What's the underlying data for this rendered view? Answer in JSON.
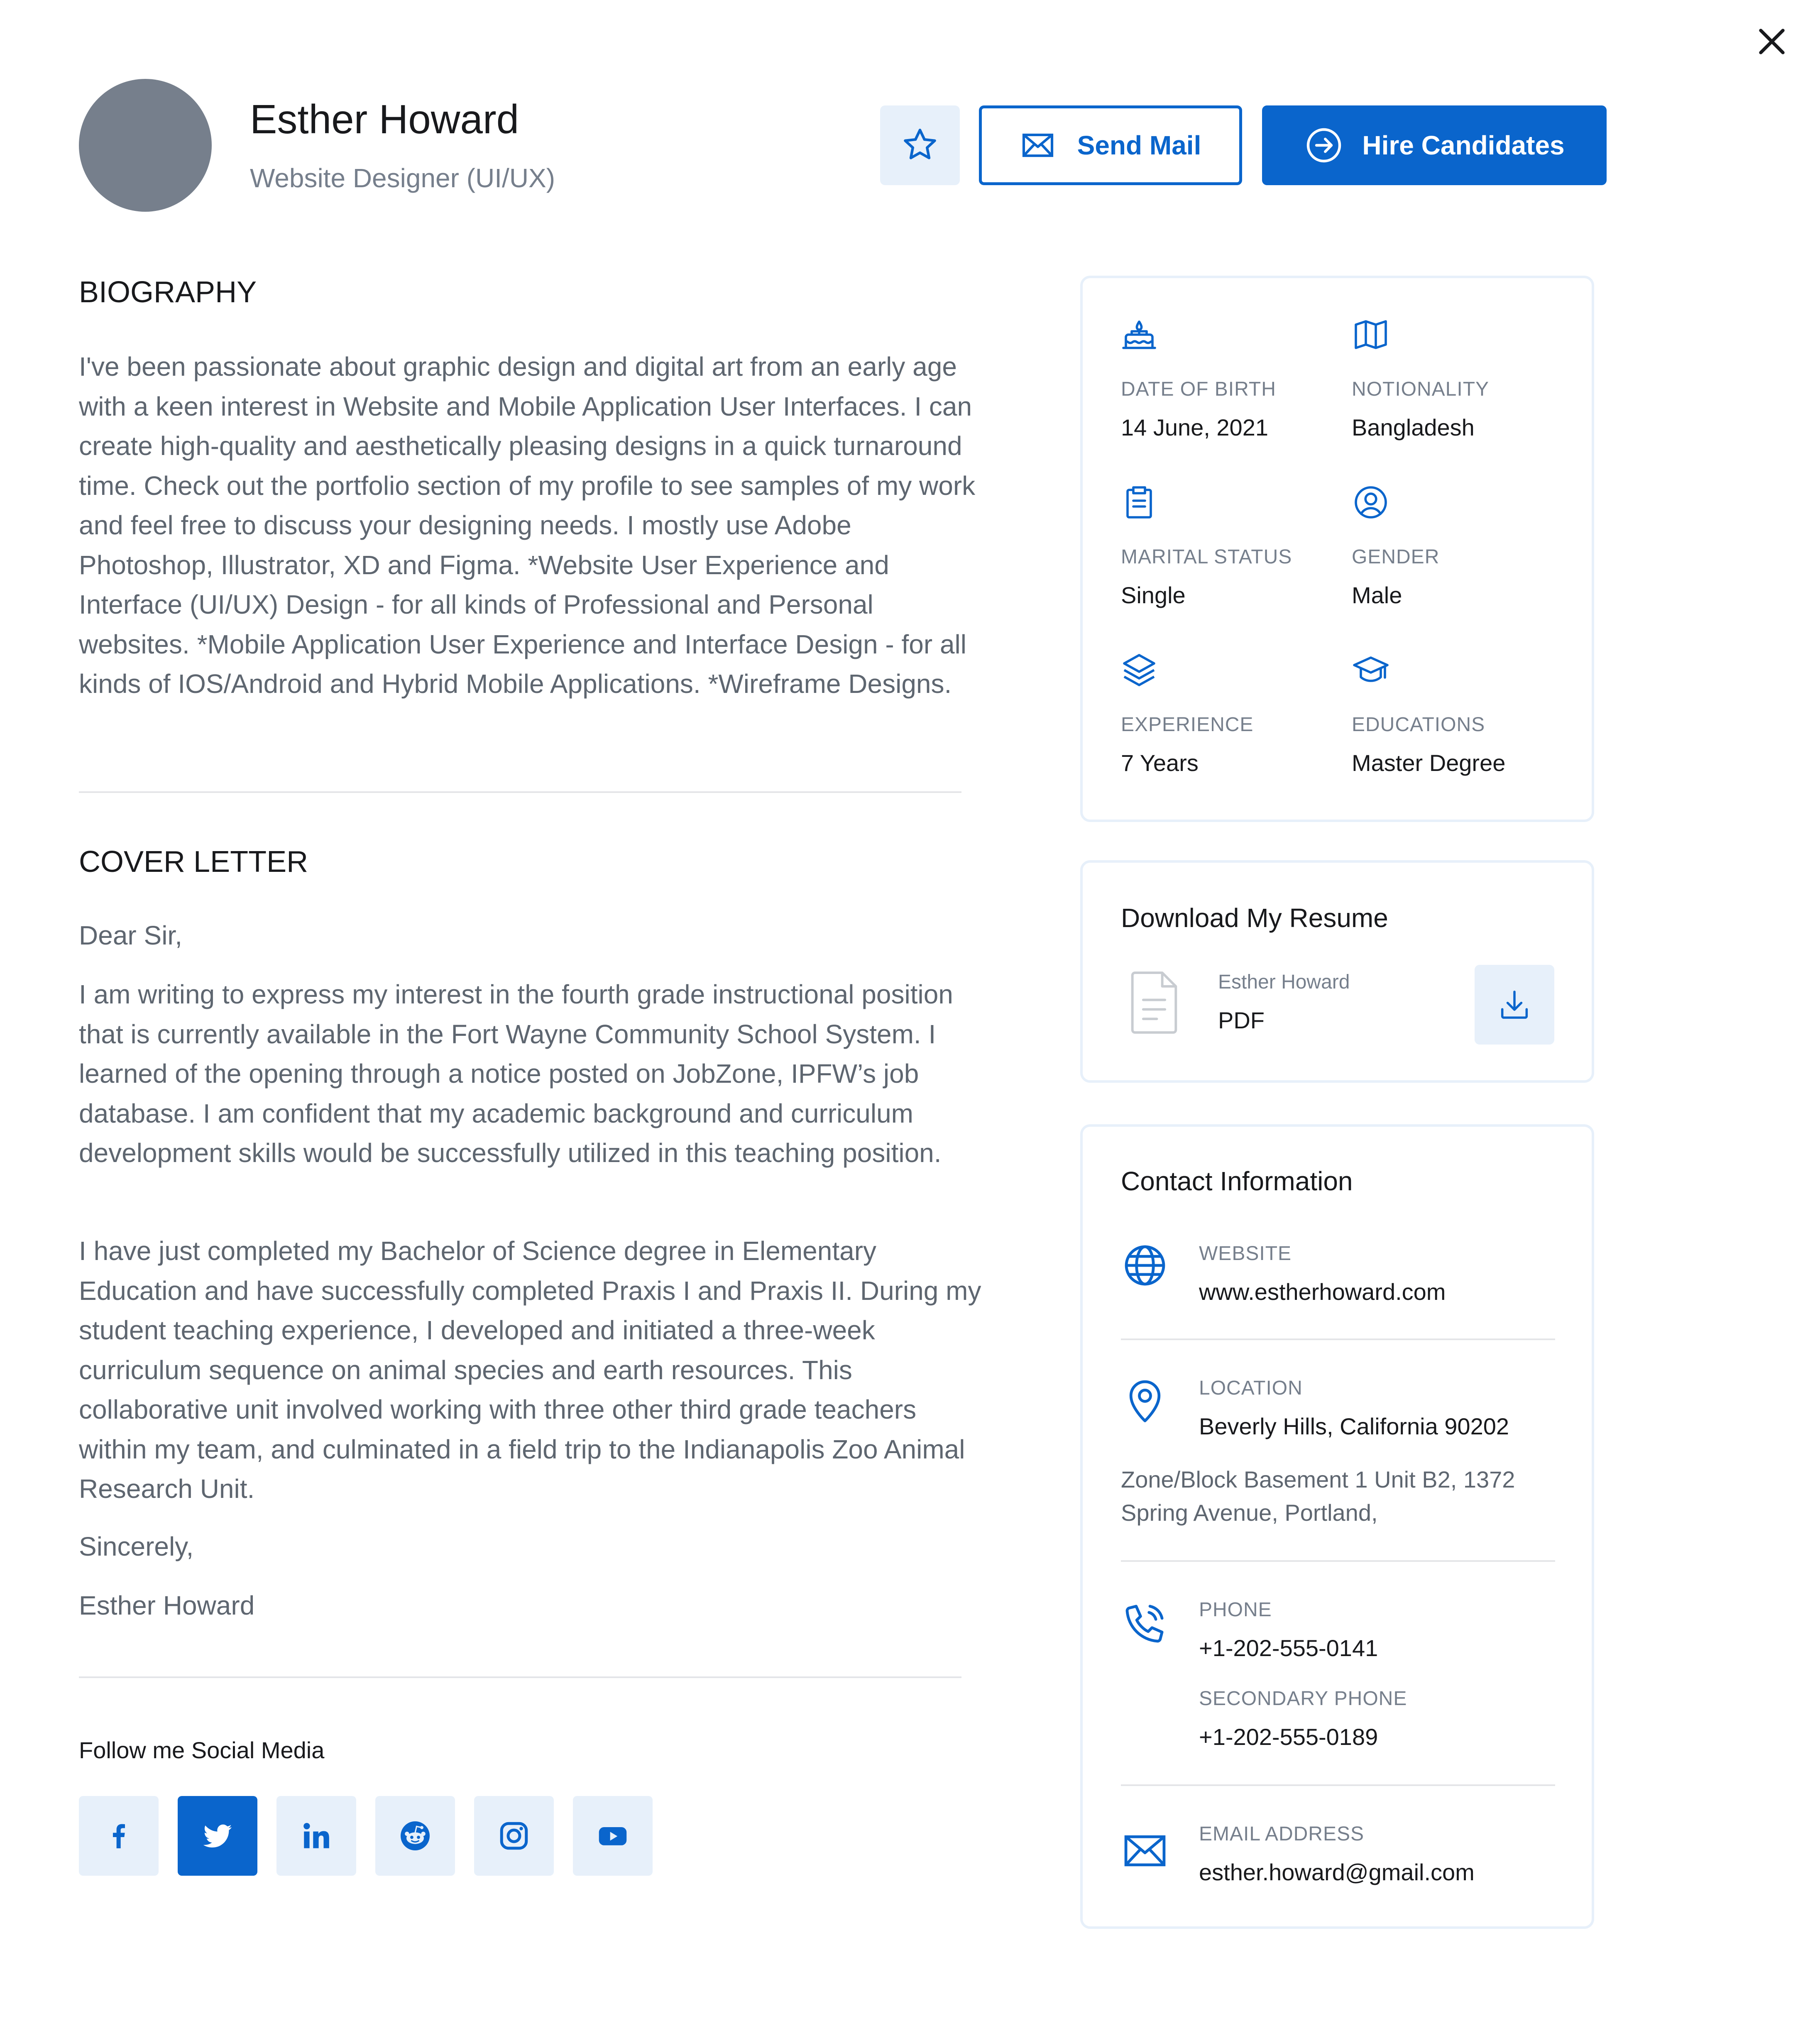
{
  "profile": {
    "name": "Esther Howard",
    "role": "Website Designer (UI/UX)"
  },
  "actions": {
    "send_mail": "Send Mail",
    "hire": "Hire Candidates"
  },
  "biography": {
    "title": "BIOGRAPHY",
    "text": "I've been passionate about graphic design and digital art from an early age with a keen interest in Website and Mobile Application User Interfaces. I can create high-quality and aesthetically pleasing designs in a quick turnaround time. Check out the portfolio section of my profile to see samples of my work and feel free to discuss your designing needs. I mostly use Adobe Photoshop, Illustrator, XD and Figma. *Website User Experience and Interface (UI/UX) Design - for all kinds of Professional and Personal websites. *Mobile Application User Experience and Interface Design - for all kinds of IOS/Android and Hybrid Mobile Applications. *Wireframe Designs."
  },
  "cover_letter": {
    "title": "COVER LETTER",
    "greeting": "Dear Sir,",
    "paragraph1": "I am writing to express my interest in the fourth grade instructional position that is currently available in the Fort Wayne Community School System. I learned of the opening through a notice posted on JobZone, IPFW’s job database. I am confident that my academic background and curriculum development skills would be successfully utilized in this teaching position.",
    "paragraph2": "I have just completed my Bachelor of Science degree in Elementary Education and have successfully completed Praxis I and Praxis II. During my student teaching experience, I developed and initiated a three-week curriculum sequence on animal species and earth resources. This collaborative unit involved working with three other third grade teachers within my team, and culminated in a field trip to the Indianapolis Zoo Animal Research Unit.",
    "closing": "Sincerely,",
    "signature": "Esther Howard"
  },
  "social": {
    "title": "Follow me Social Media",
    "items": [
      {
        "name": "facebook",
        "icon": "facebook-icon",
        "active": false
      },
      {
        "name": "twitter",
        "icon": "twitter-icon",
        "active": true
      },
      {
        "name": "linkedin",
        "icon": "linkedin-icon",
        "active": false
      },
      {
        "name": "reddit",
        "icon": "reddit-icon",
        "active": false
      },
      {
        "name": "instagram",
        "icon": "instagram-icon",
        "active": false
      },
      {
        "name": "youtube",
        "icon": "youtube-icon",
        "active": false
      }
    ]
  },
  "overview": {
    "items": [
      {
        "icon": "cake-icon",
        "label": "DATE OF BIRTH",
        "value": "14 June, 2021"
      },
      {
        "icon": "map-icon",
        "label": "NOTIONALITY",
        "value": "Bangladesh"
      },
      {
        "icon": "clipboard-icon",
        "label": "MARITAL STATUS",
        "value": "Single"
      },
      {
        "icon": "user-circle-icon",
        "label": "GENDER",
        "value": "Male"
      },
      {
        "icon": "stack-icon",
        "label": "EXPERIENCE",
        "value": "7 Years"
      },
      {
        "icon": "graduation-cap-icon",
        "label": "EDUCATIONS",
        "value": "Master Degree"
      }
    ]
  },
  "resume": {
    "title": "Download My Resume",
    "file_owner": "Esther Howard",
    "file_type": "PDF"
  },
  "contact": {
    "title": "Contact Information",
    "website_label": "WEBSITE",
    "website": "www.estherhoward.com",
    "location_label": "LOCATION",
    "location": "Beverly Hills, California 90202",
    "address": "Zone/Block Basement 1 Unit B2, 1372 Spring Avenue, Portland,",
    "phone_label": "PHONE",
    "phone": "+1-202-555-0141",
    "secondary_phone_label": "SECONDARY PHONE",
    "secondary_phone": "+1-202-555-0189",
    "email_label": "EMAIL ADDRESS",
    "email": "esther.howard@gmail.com"
  },
  "colors": {
    "primary": "#0a65cc",
    "primary_light": "#e7f0fa",
    "avatar": "#767f8c",
    "text_dark": "#18191c",
    "text_gray": "#5e6670",
    "text_muted": "#767f8c"
  }
}
